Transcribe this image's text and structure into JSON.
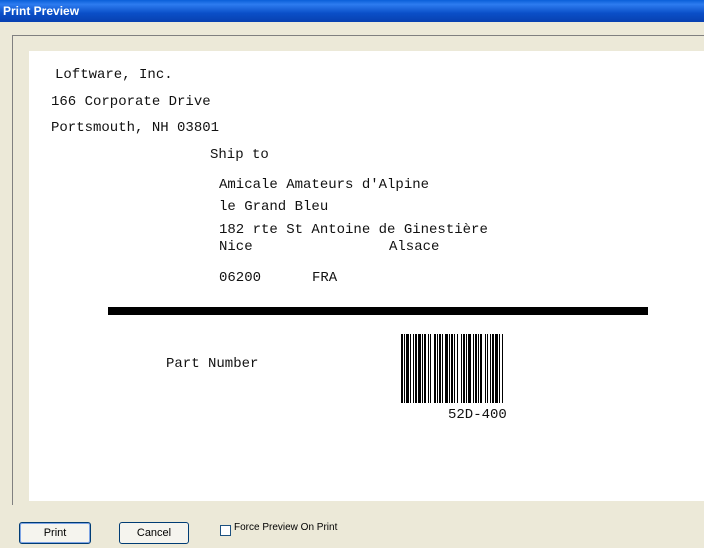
{
  "window": {
    "title": "Print Preview"
  },
  "label": {
    "from_lines": [
      "Loftware, Inc.",
      "166 Corporate Drive",
      "Portsmouth, NH 03801"
    ],
    "ship_to_label": "Ship to",
    "to_lines": [
      "Amicale Amateurs d'Alpine",
      "le Grand Bleu",
      "182 rte St Antoine de Ginestière"
    ],
    "city": "Nice",
    "region": "Alsace",
    "postal_code": "06200",
    "country": "FRA",
    "part_number_label": "Part Number",
    "barcode_value": "52D-400"
  },
  "buttons": {
    "print": "Print",
    "cancel": "Cancel"
  },
  "options": {
    "force_preview_label": "Force Preview On Print",
    "force_preview_checked": false
  }
}
